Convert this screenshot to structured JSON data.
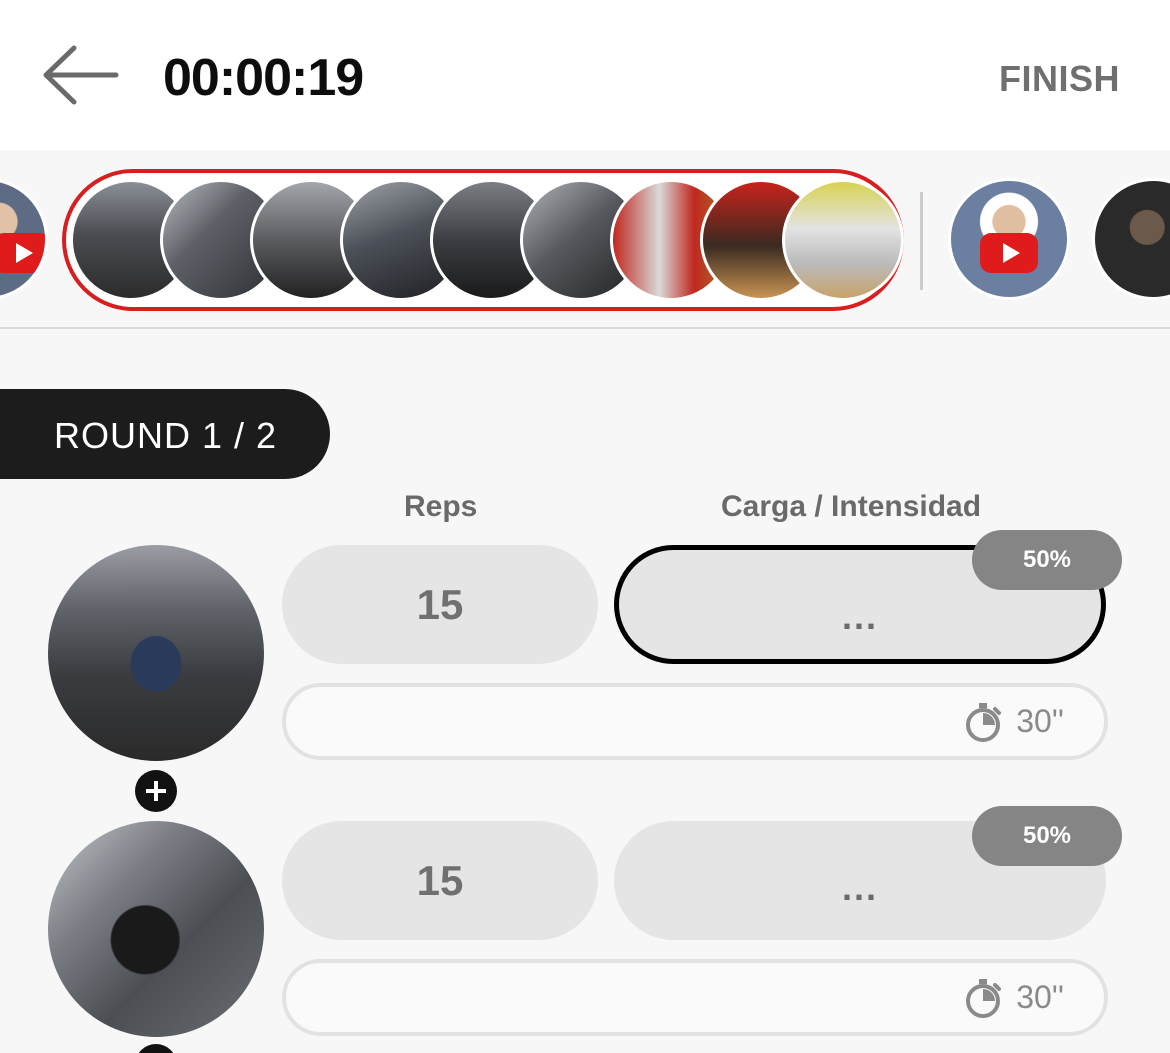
{
  "header": {
    "timer": "00:00:19",
    "finish_label": "FINISH",
    "back_icon": "arrow-left-icon"
  },
  "round": {
    "label": "ROUND 1 / 2"
  },
  "columns": {
    "reps": "Reps",
    "load": "Carga / Intensidad"
  },
  "exercises": [
    {
      "reps": "15",
      "load": "...",
      "intensity": "50%",
      "rest": "30''",
      "image": "bench-press"
    },
    {
      "reps": "15",
      "load": "...",
      "intensity": "50%",
      "rest": "30''",
      "image": "leg-press"
    }
  ],
  "colors": {
    "accent_red": "#d81f1f",
    "dark": "#1c1c1c",
    "pill_gray": "#858585",
    "field_gray": "#e5e5e5"
  }
}
